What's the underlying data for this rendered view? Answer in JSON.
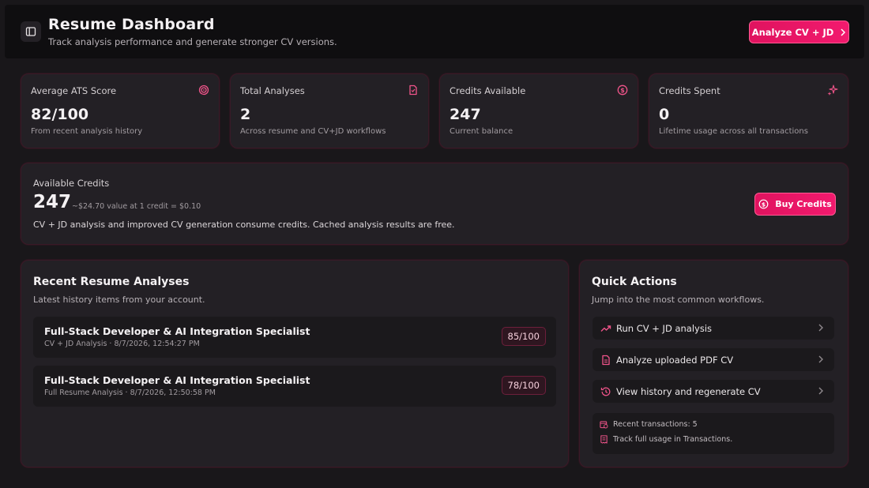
{
  "header": {
    "title": "Resume Dashboard",
    "subtitle": "Track analysis performance and generate stronger CV versions.",
    "analyze_button": "Analyze CV + JD"
  },
  "stats": [
    {
      "label": "Average ATS Score",
      "value": "82/100",
      "sub": "From recent analysis history",
      "icon": "target-icon"
    },
    {
      "label": "Total Analyses",
      "value": "2",
      "sub": "Across resume and CV+JD workflows",
      "icon": "file-icon"
    },
    {
      "label": "Credits Available",
      "value": "247",
      "sub": "Current balance",
      "icon": "dollar-circle-icon"
    },
    {
      "label": "Credits Spent",
      "value": "0",
      "sub": "Lifetime usage across all transactions",
      "icon": "sparkles-icon"
    }
  ],
  "credits": {
    "label": "Available Credits",
    "value": "247",
    "note": "~$24.70 value at 1 credit = $0.10",
    "description": "CV + JD analysis and improved CV generation consume credits. Cached analysis results are free.",
    "buy_button": "Buy Credits"
  },
  "recent": {
    "title": "Recent Resume Analyses",
    "subtitle": "Latest history items from your account.",
    "items": [
      {
        "title": "Full-Stack Developer & AI Integration Specialist",
        "meta": "CV + JD Analysis · 8/7/2026, 12:54:27 PM",
        "score": "85/100"
      },
      {
        "title": "Full-Stack Developer & AI Integration Specialist",
        "meta": "Full Resume Analysis · 8/7/2026, 12:50:58 PM",
        "score": "78/100"
      }
    ]
  },
  "quick_actions": {
    "title": "Quick Actions",
    "subtitle": "Jump into the most common workflows.",
    "items": [
      {
        "label": "Run CV + JD analysis",
        "icon": "trending-up-icon"
      },
      {
        "label": "Analyze uploaded PDF CV",
        "icon": "file-text-icon"
      },
      {
        "label": "View history and regenerate CV",
        "icon": "history-icon"
      }
    ],
    "info": {
      "transactions": "Recent transactions: 5",
      "track": "Track full usage in Transactions."
    }
  },
  "colors": {
    "accent": "#e8166a",
    "background": "#19171a",
    "card": "#232025",
    "card_border": "#3a1a27"
  }
}
